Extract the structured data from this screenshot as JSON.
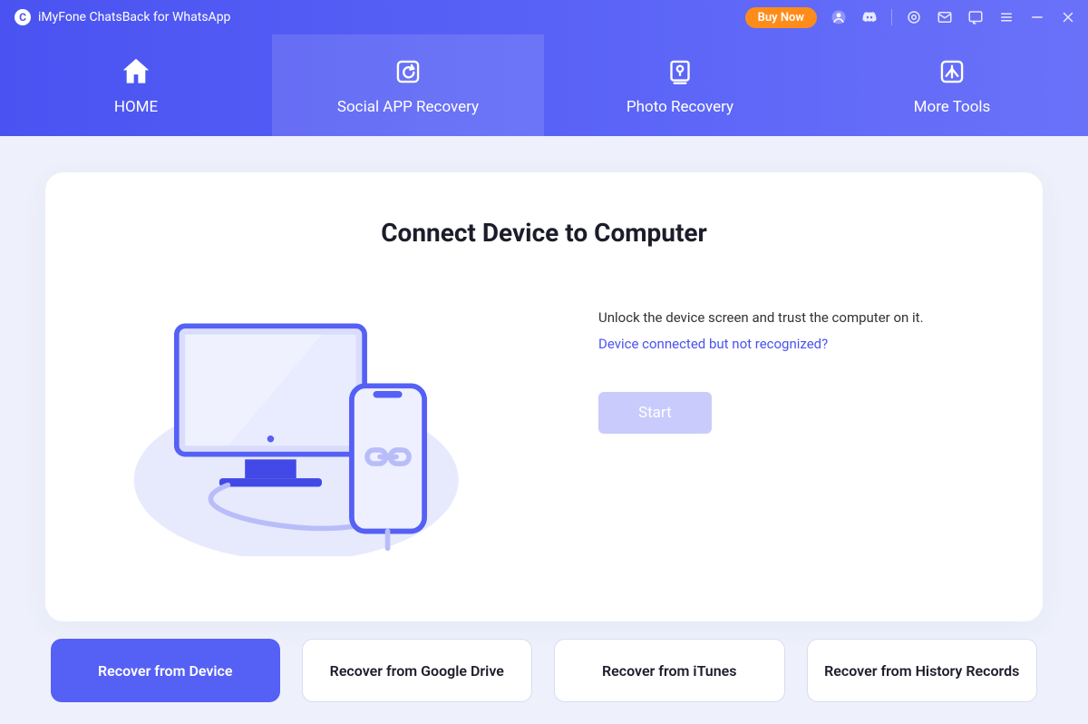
{
  "app_title": "iMyFone ChatsBack for WhatsApp",
  "topbar": {
    "buy_label": "Buy Now"
  },
  "tabs": [
    {
      "label": "HOME"
    },
    {
      "label": "Social APP Recovery"
    },
    {
      "label": "Photo Recovery"
    },
    {
      "label": "More Tools"
    }
  ],
  "main": {
    "title": "Connect Device to Computer",
    "instruction": "Unlock the device screen and trust the computer on it.",
    "help_link": "Device connected but not recognized?",
    "start_label": "Start"
  },
  "options": [
    "Recover from Device",
    "Recover from Google Drive",
    "Recover from iTunes",
    "Recover from History Records"
  ]
}
